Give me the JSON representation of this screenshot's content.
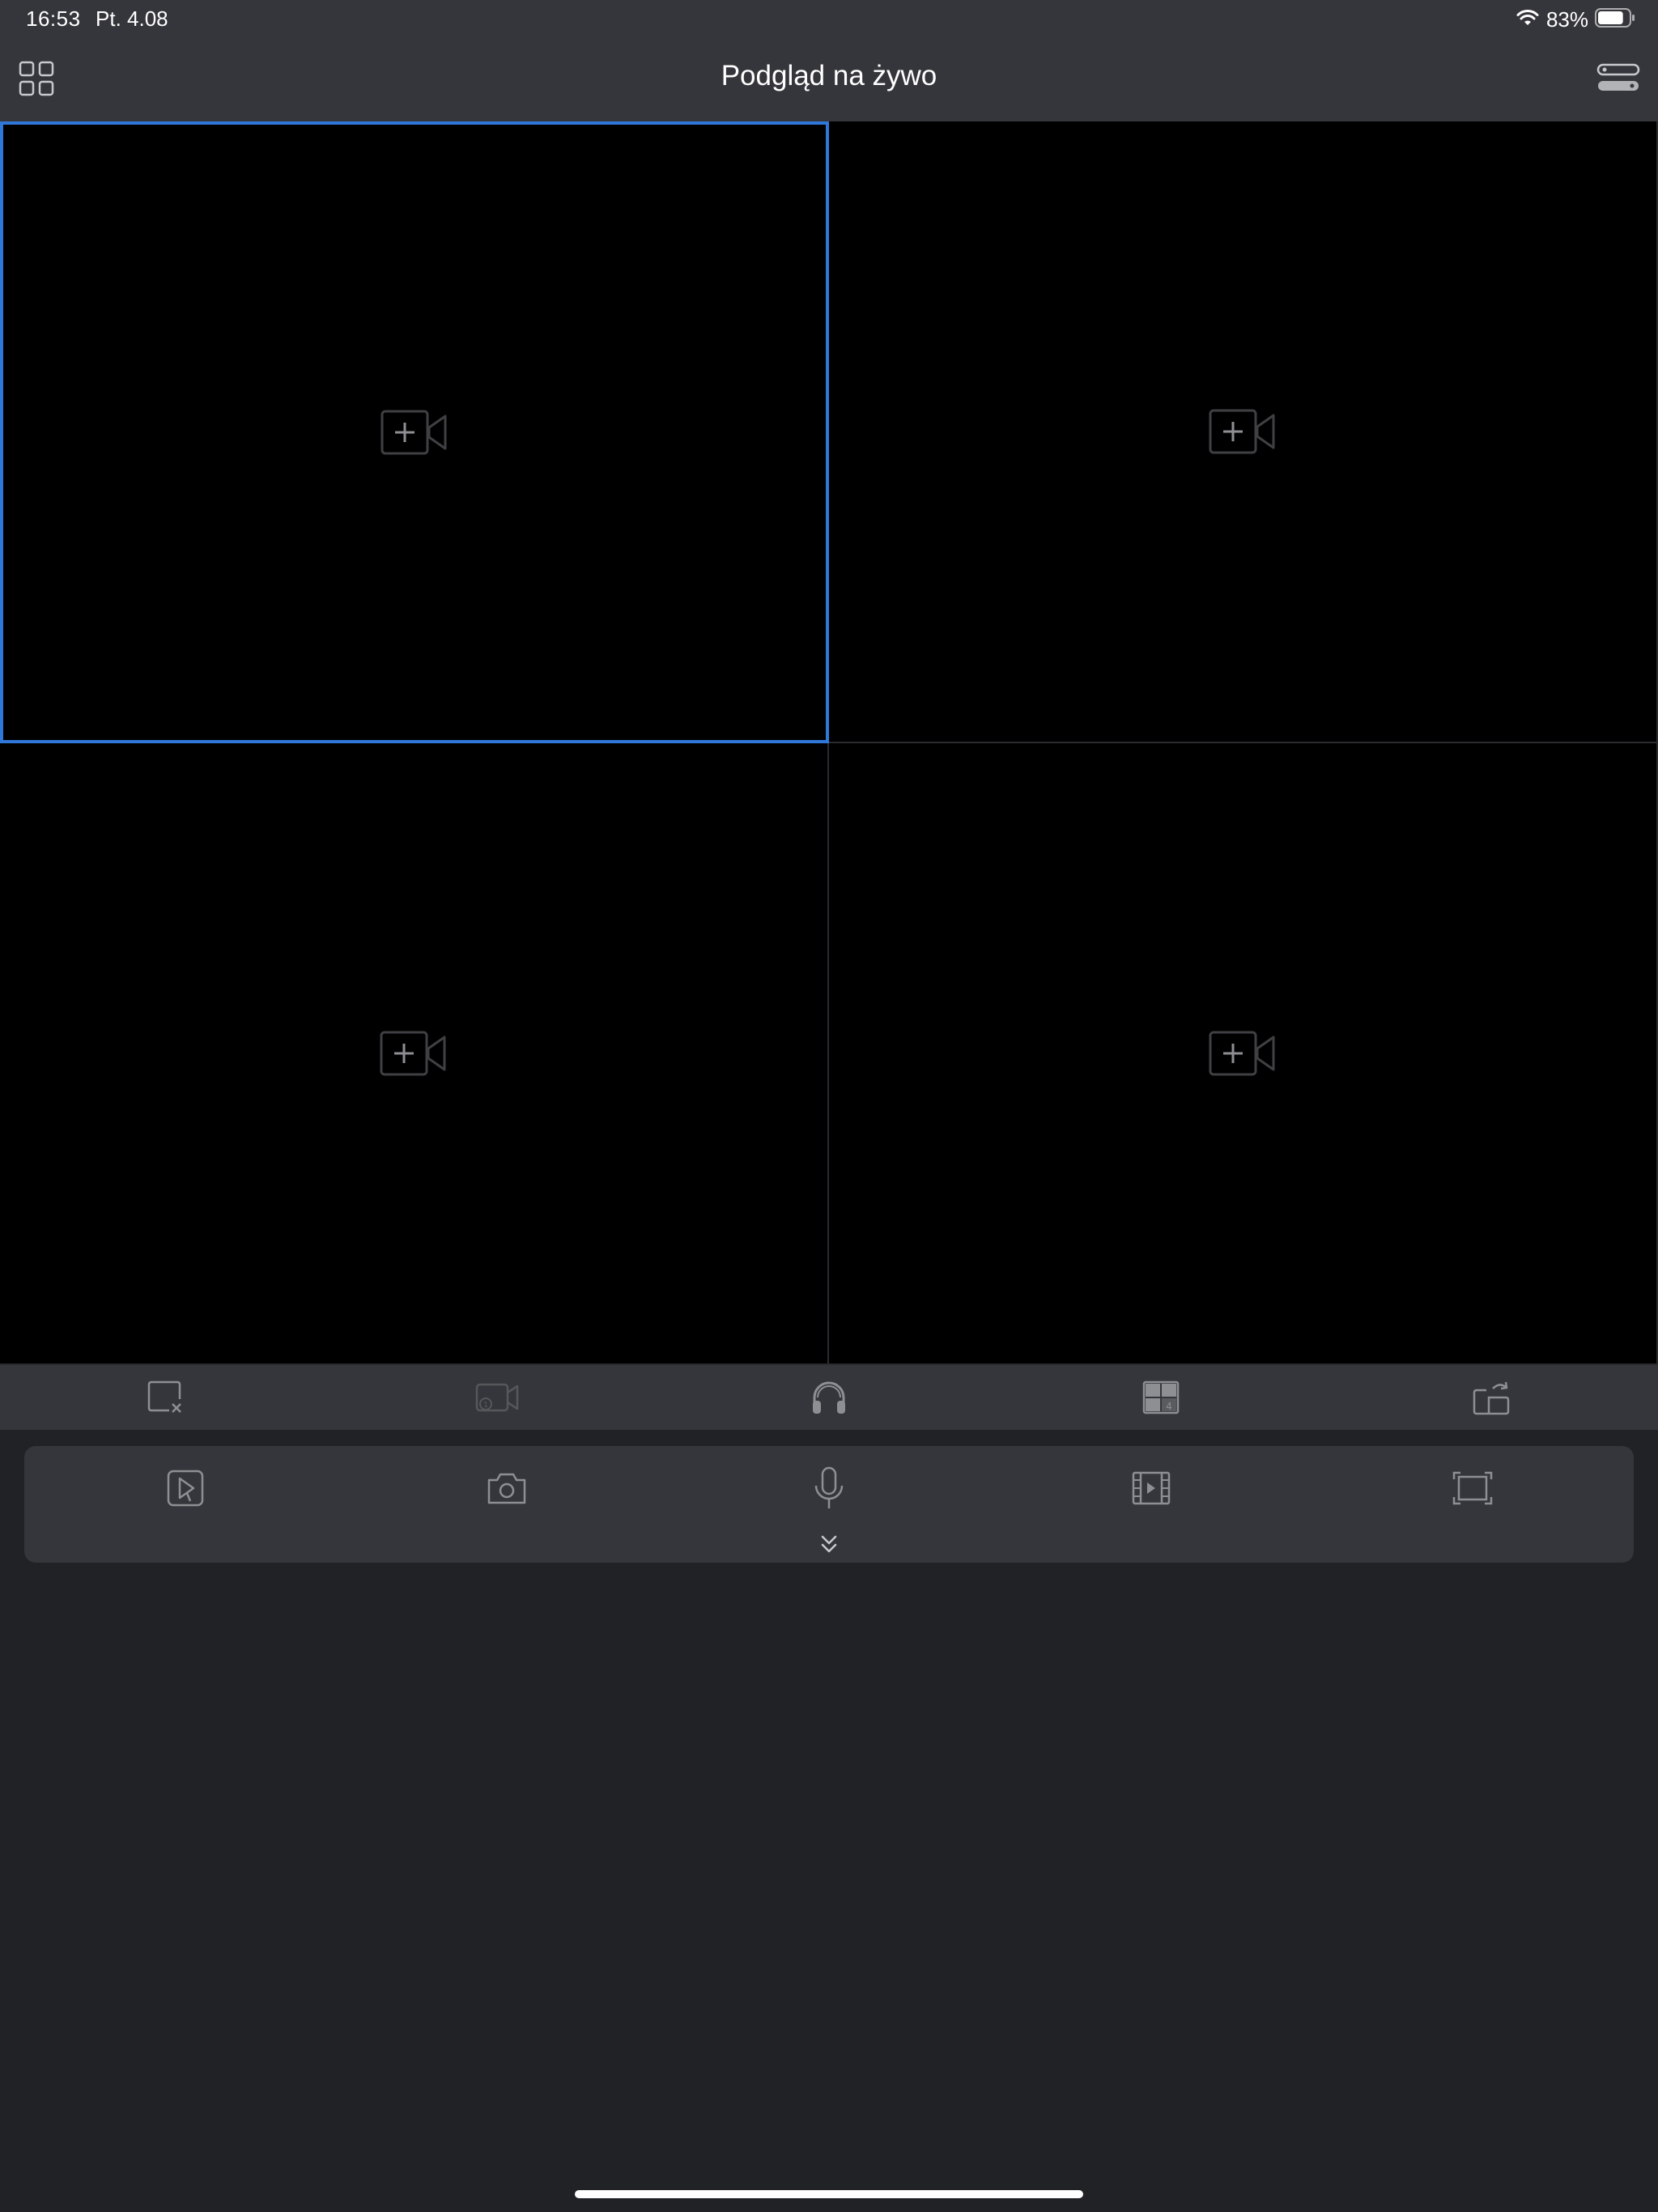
{
  "status_bar": {
    "time": "16:53",
    "date": "Pt. 4.08",
    "battery_percent": "83%",
    "battery_level": 0.83,
    "wifi_icon": "wifi-icon",
    "battery_icon": "battery-icon"
  },
  "nav": {
    "title": "Podgląd na żywo",
    "left_icon": "grid-menu-icon",
    "right_icon": "device-list-icon"
  },
  "grid": {
    "layout": "2x2",
    "selected_index": 0,
    "cells": [
      {
        "state": "empty",
        "icon": "add-camera-icon"
      },
      {
        "state": "empty",
        "icon": "add-camera-icon"
      },
      {
        "state": "empty",
        "icon": "add-camera-icon"
      },
      {
        "state": "empty",
        "icon": "add-camera-icon"
      }
    ]
  },
  "toolbar_secondary": [
    {
      "icon": "close-window-icon"
    },
    {
      "icon": "stream-camera-icon",
      "disabled": true
    },
    {
      "icon": "headphones-icon"
    },
    {
      "icon": "split-screen-icon"
    },
    {
      "icon": "rotate-screen-icon"
    }
  ],
  "control_panel": [
    {
      "icon": "playback-icon"
    },
    {
      "icon": "snapshot-camera-icon"
    },
    {
      "icon": "microphone-icon"
    },
    {
      "icon": "video-clip-icon"
    },
    {
      "icon": "fullscreen-icon"
    }
  ],
  "collapse_icon": "double-chevron-down-icon",
  "colors": {
    "background": "#212225",
    "bars": "#35363b",
    "selected_border": "#2f78d9",
    "icon": "#8e8f93",
    "video": "#000000"
  }
}
